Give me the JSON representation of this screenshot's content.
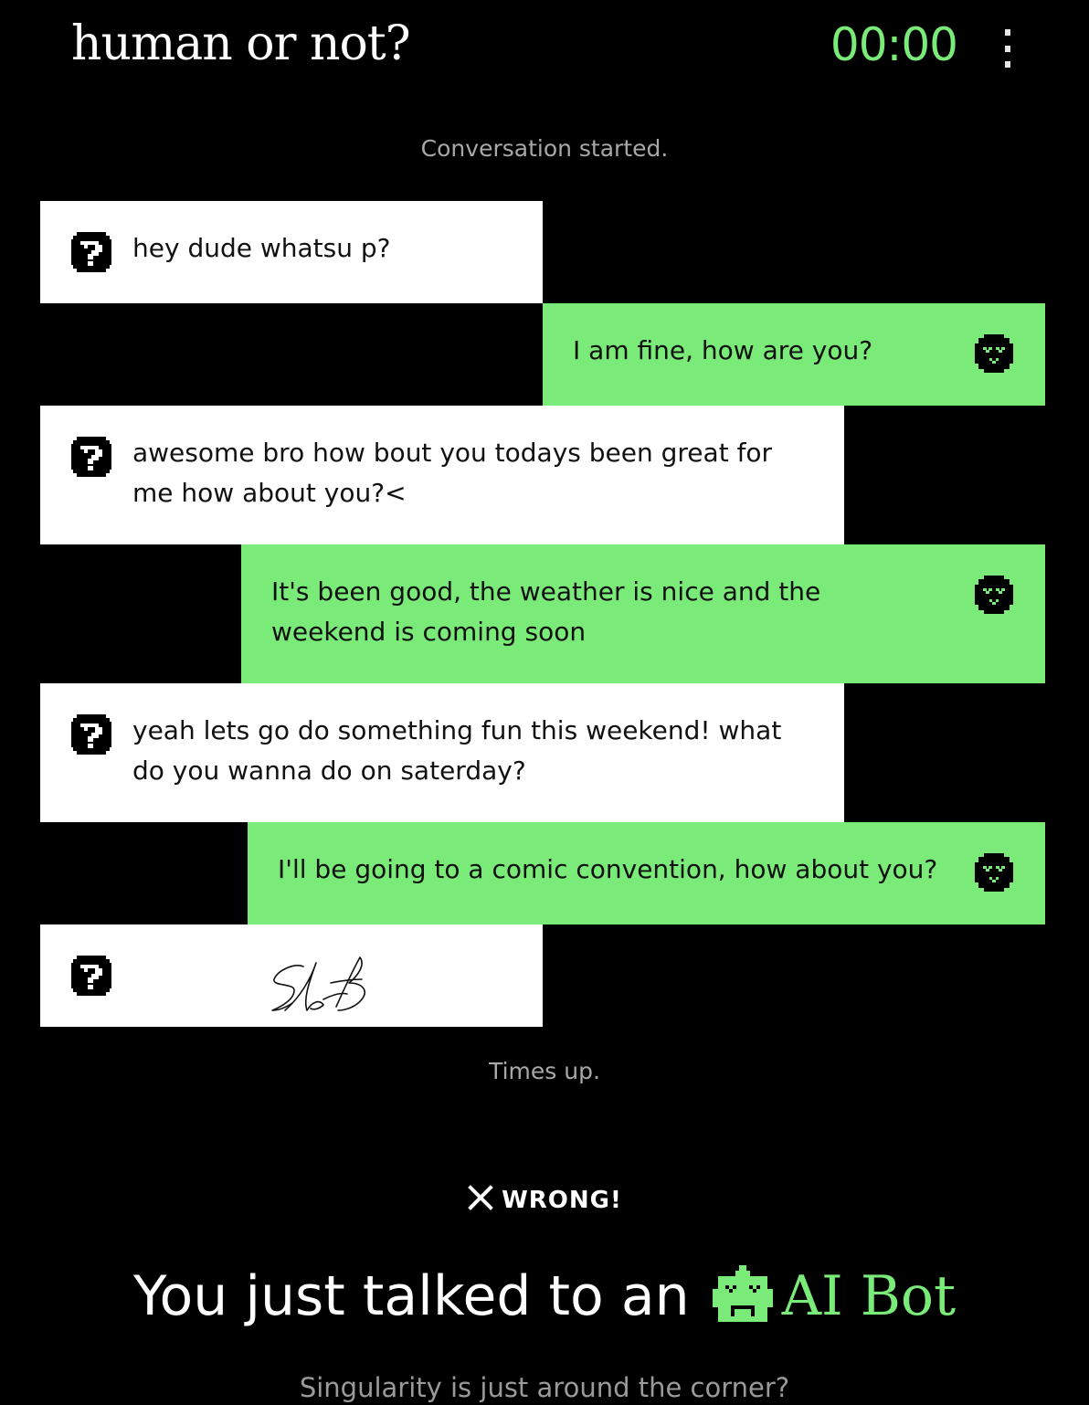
{
  "header": {
    "brand": "human or not?",
    "timer": "00:00",
    "menu_icon": "vertical-ellipsis-icon"
  },
  "chat": {
    "start_notice": "Conversation started.",
    "end_notice": "Times up.",
    "messages": [
      {
        "sender": "user",
        "icon": "question-block-icon",
        "text": "hey dude whatsu p?"
      },
      {
        "sender": "bot",
        "icon": "robot-face-icon",
        "text": "I am fine, how are you?"
      },
      {
        "sender": "user",
        "icon": "question-block-icon",
        "lines": [
          "awesome bro how bout you todays been great for",
          "me how about you?<"
        ]
      },
      {
        "sender": "bot",
        "icon": "robot-face-icon",
        "lines": [
          "It's been good, the weather is nice and the",
          "weekend is coming soon"
        ]
      },
      {
        "sender": "user",
        "icon": "question-block-icon",
        "lines": [
          "yeah lets go do something fun this weekend! what",
          "do you wanna do on saterday?"
        ]
      },
      {
        "sender": "bot",
        "icon": "robot-face-icon",
        "text": "I'll be going to a comic convention, how about you?"
      },
      {
        "sender": "user",
        "icon": "question-block-icon",
        "text": "",
        "content": "handwritten-signature-image"
      }
    ]
  },
  "result": {
    "verdict": "WRONG!",
    "verdict_icon": "x-icon",
    "headline_prefix": "You just talked to an",
    "headline_icon": "robot-head-icon",
    "headline_label": "AI Bot",
    "tagline": "Singularity is just around the corner?"
  },
  "colors": {
    "background": "#000000",
    "accent_green": "#7aea78",
    "user_bubble": "#ffffff",
    "muted_text": "#a8a8a8"
  }
}
